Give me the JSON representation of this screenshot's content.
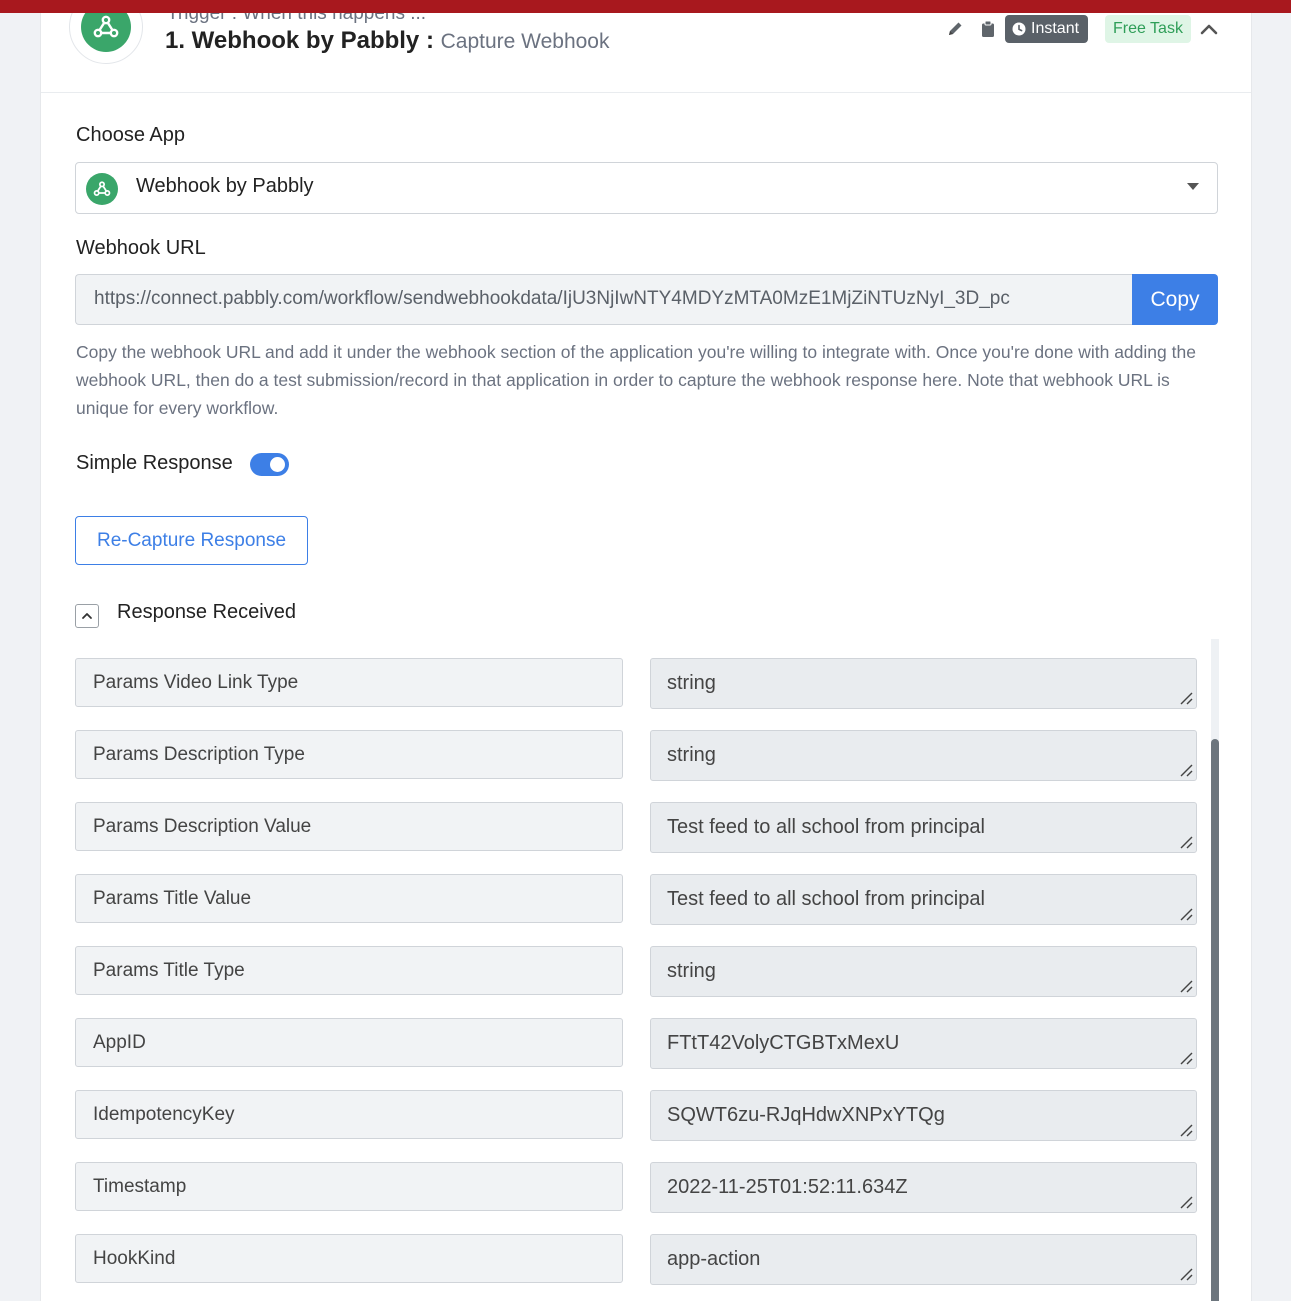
{
  "header": {
    "trigger_subtitle": "Trigger : When this happens ...",
    "step_title": "1. Webhook by Pabbly",
    "separator": " : ",
    "event_name": "Capture Webhook",
    "instant_badge": "Instant",
    "free_task_badge": "Free Task"
  },
  "form": {
    "choose_app_label": "Choose App",
    "selected_app": "Webhook by Pabbly",
    "webhook_url_label": "Webhook URL",
    "webhook_url_value": "https://connect.pabbly.com/workflow/sendwebhookdata/IjU3NjIwNTY4MDYzMTA0MzE1MjZiNTUzNyI_3D_pc",
    "copy_label": "Copy",
    "help_text": "Copy the webhook URL and add it under the webhook section of the application you're willing to integrate with. Once you're done with adding the webhook URL, then do a test submission/record in that application in order to capture the webhook response here. Note that webhook URL is unique for every workflow.",
    "simple_response_label": "Simple Response",
    "simple_response_on": true,
    "recapture_label": "Re-Capture Response",
    "response_received_label": "Response Received"
  },
  "response_rows": [
    {
      "key": "Params Video Link Type",
      "value": "string"
    },
    {
      "key": "Params Description Type",
      "value": "string"
    },
    {
      "key": "Params Description Value",
      "value": "Test feed to all school from principal"
    },
    {
      "key": "Params Title Value",
      "value": "Test feed to all school from principal"
    },
    {
      "key": "Params Title Type",
      "value": "string"
    },
    {
      "key": "AppID",
      "value": "FTtT42VolyCTGBTxMexU"
    },
    {
      "key": "IdempotencyKey",
      "value": "SQWT6zu-RJqHdwXNPxYTQg"
    },
    {
      "key": "Timestamp",
      "value": "2022-11-25T01:52:11.634Z"
    },
    {
      "key": "HookKind",
      "value": "app-action"
    }
  ],
  "colors": {
    "accent": "#3d7fe6",
    "app_green": "#3aa66a",
    "top_strip": "#a8181e"
  },
  "icons": {
    "edit": "pencil-icon",
    "delete": "clipboard-icon",
    "instant": "clock-icon",
    "collapse": "chevron-up-icon",
    "app": "webhook-icon"
  }
}
